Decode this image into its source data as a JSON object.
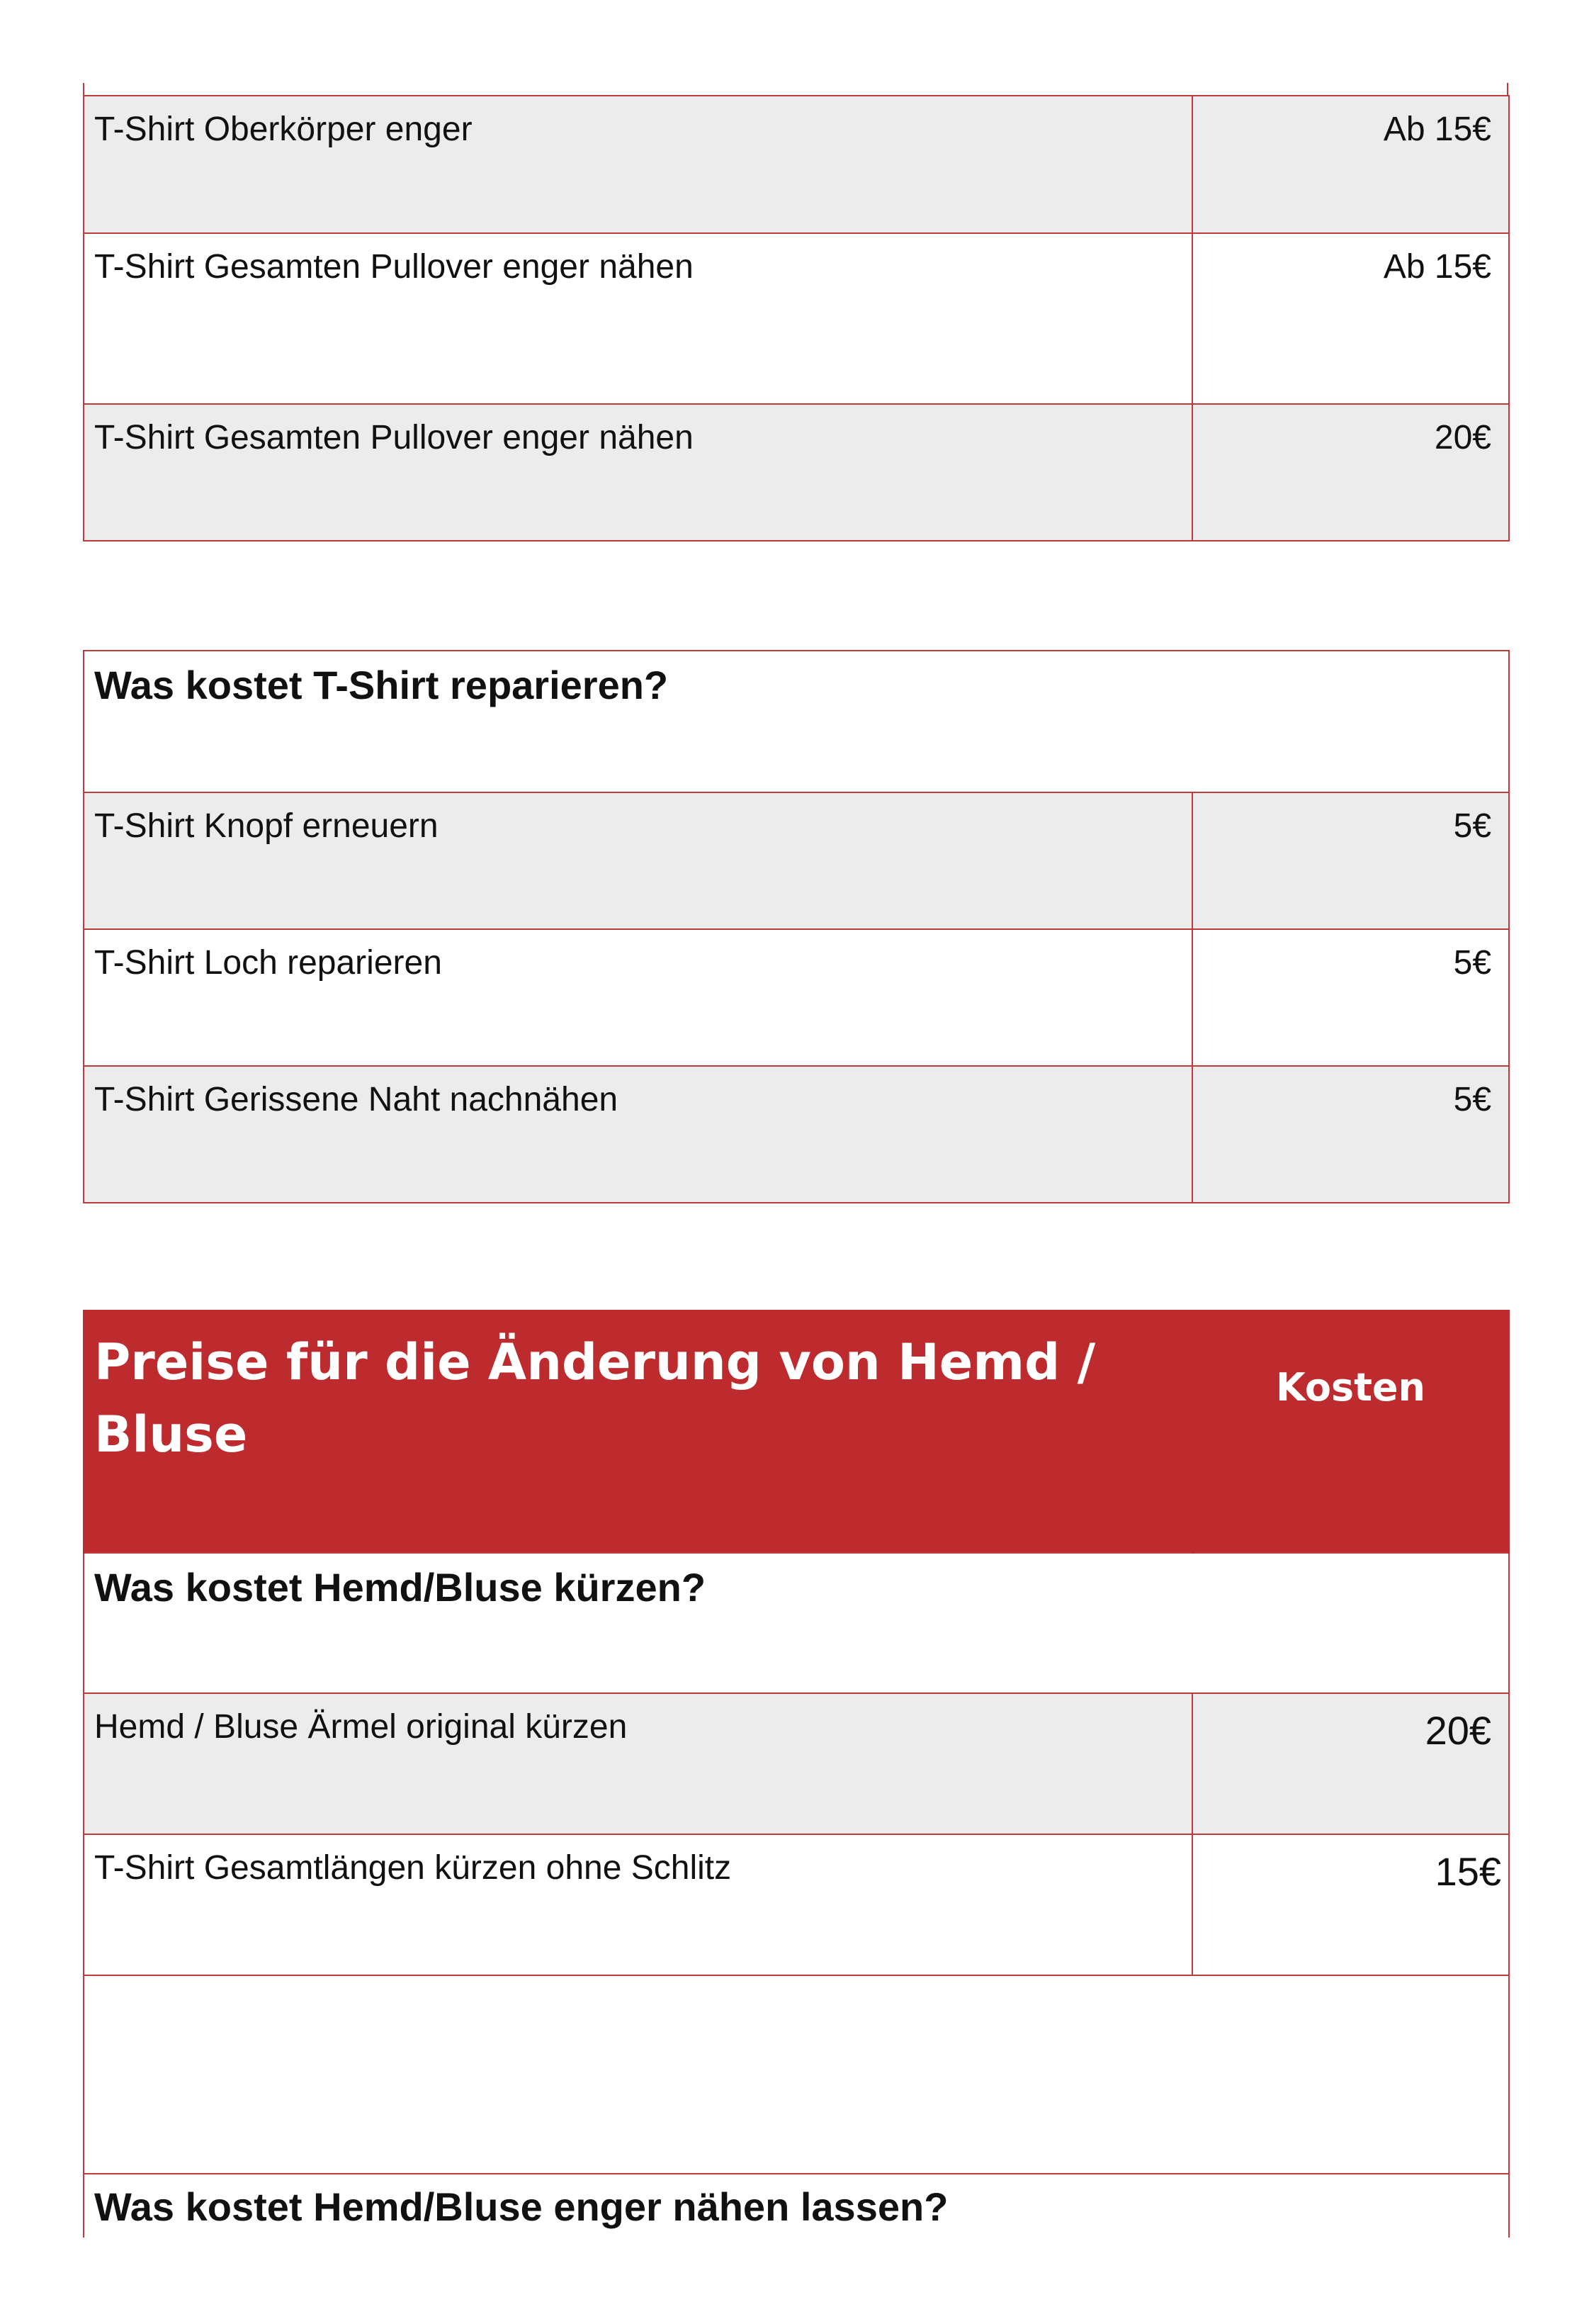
{
  "tshirt_enger_rows": [
    {
      "label": "T-Shirt Oberkörper enger",
      "price": "Ab 15€"
    },
    {
      "label": "T-Shirt Gesamten Pullover enger nähen",
      "price": "Ab 15€"
    },
    {
      "label": "T-Shirt Gesamten Pullover enger nähen",
      "price": "20€"
    }
  ],
  "tshirt_reparieren": {
    "heading": "Was kostet T-Shirt reparieren?",
    "rows": [
      {
        "label": "T-Shirt Knopf erneuern",
        "price": "5€"
      },
      {
        "label": "T-Shirt Loch reparieren",
        "price": "5€"
      },
      {
        "label": "T-Shirt Gerissene Naht nachnähen",
        "price": "5€"
      }
    ]
  },
  "hemd_bluse": {
    "title": "Preise für die Änderung von Hemd / Bluse",
    "cost_header": "Kosten",
    "kuerzen_heading": "Was kostet Hemd/Bluse kürzen?",
    "kuerzen_rows": [
      {
        "label": "Hemd / Bluse Ärmel original kürzen",
        "price": "20€"
      },
      {
        "label": "T-Shirt Gesamtlängen kürzen ohne Schlitz",
        "price": "15€"
      }
    ],
    "enger_heading": "Was kostet Hemd/Bluse enger nähen lassen?"
  }
}
